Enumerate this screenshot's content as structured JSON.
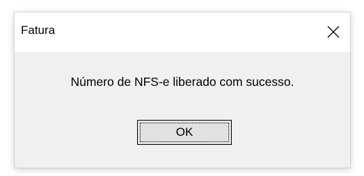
{
  "window": {
    "title": "Fatura",
    "close_icon": "close-icon"
  },
  "message": {
    "text": "Número de NFS-e liberado com sucesso."
  },
  "buttons": {
    "ok_label": "OK"
  }
}
